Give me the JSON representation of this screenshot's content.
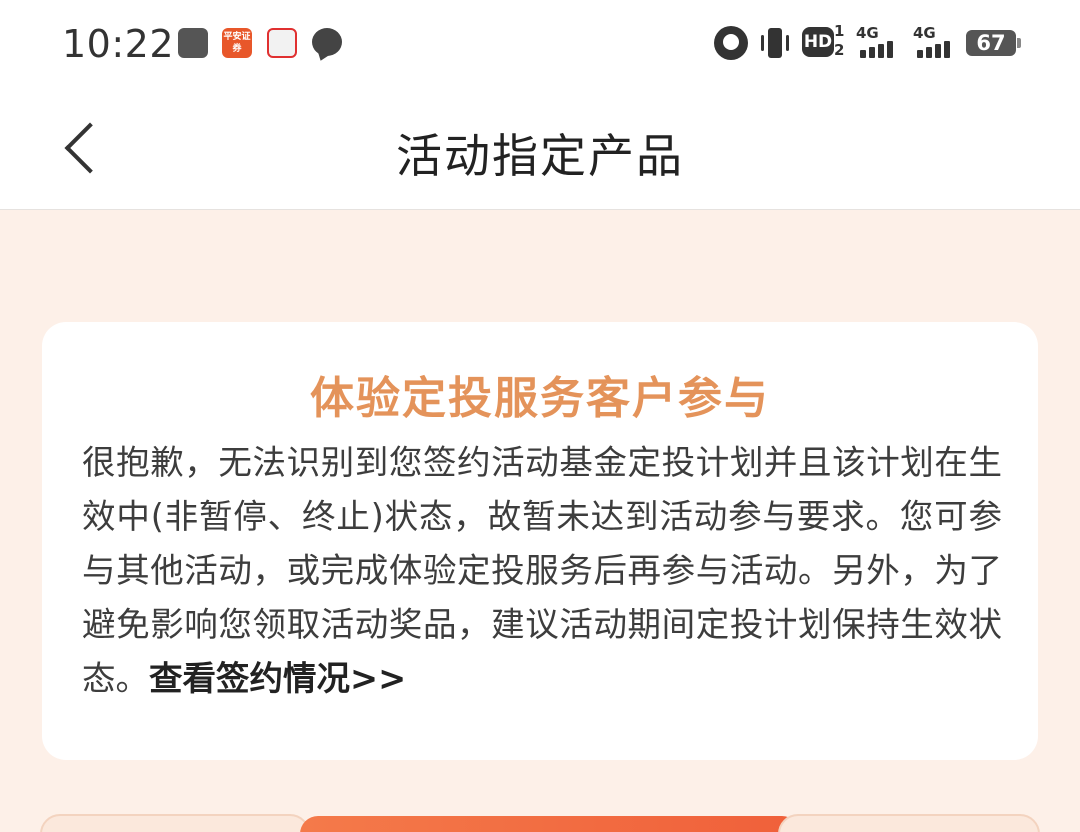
{
  "status_bar": {
    "time": "10:22",
    "icons": [
      "scissors-app-icon",
      "pingan-securities-icon",
      "red-app-icon",
      "chat-bubble-icon",
      "alarm-icon",
      "vibrate-icon",
      "hd-icon",
      "signal-4g-icon",
      "signal-4g-icon",
      "battery-icon"
    ],
    "pingan_label": "平安证券",
    "hd_label": "HD",
    "hd_sub": "1\n2",
    "signal1_label": "4G",
    "signal2_label": "4G",
    "battery_level": "67"
  },
  "nav": {
    "title": "活动指定产品"
  },
  "card": {
    "title": "体验定投服务客户参与",
    "body": "很抱歉，无法识别到您签约活动基金定投计划并且该计划在生效中(非暂停、终止)状态，故暂未达到活动参与要求。您可参与其他活动，或完成体验定投服务后再参与活动。另外，为了避免影响您领取活动奖品，建议活动期间定投计划保持生效状态。",
    "link": "查看签约情况>>"
  },
  "colors": {
    "page_background": "#fdf0e8",
    "card_title": "#e4935a",
    "bottom_button": "#f0603a"
  }
}
